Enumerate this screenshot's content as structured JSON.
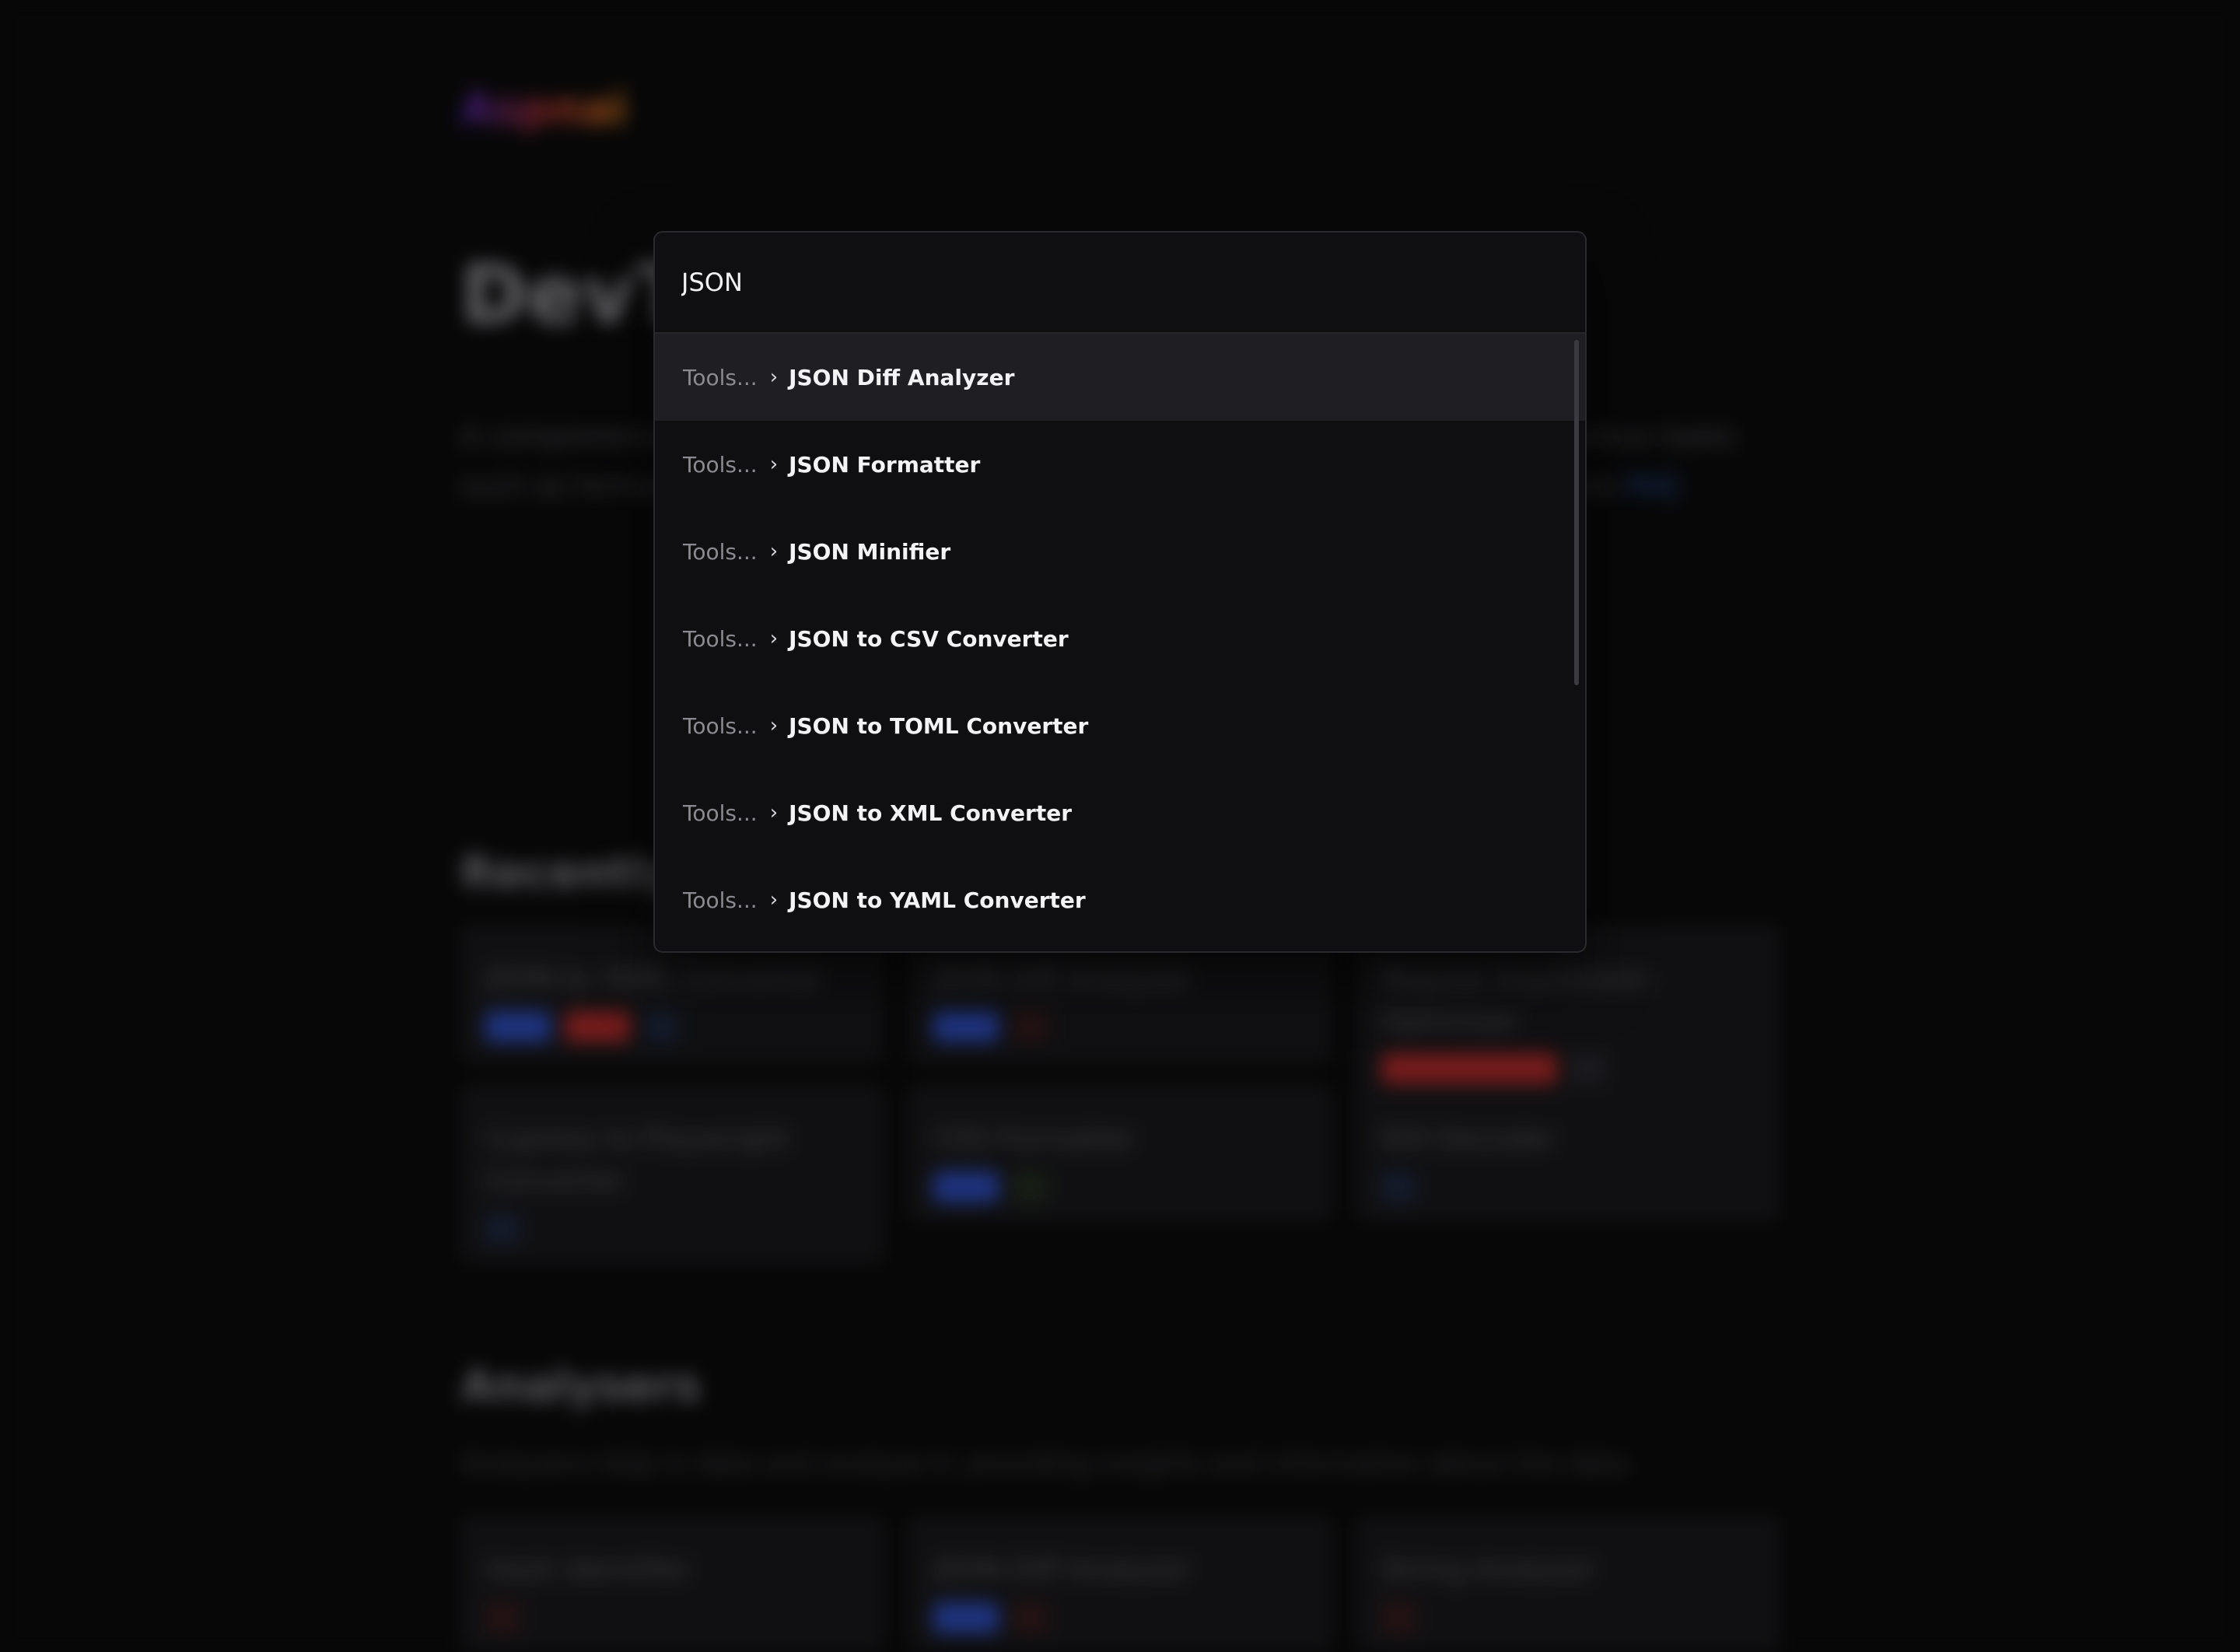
{
  "background": {
    "logo": "Aspnai",
    "hero_title": "DevToolbox",
    "hero_description": "A comprehensive collection of developer tools designed to help you facilitate various tasks such as formatting, converting, analyzing and generating data. Explore them here",
    "hero_link": "FAQ",
    "recent_title": "Recently Used",
    "recent_cards": [
      {
        "title": "JSON to YAML Converter",
        "tags": [
          "blue",
          "red",
          "dimblue"
        ]
      },
      {
        "title": "JSON Diff Analyzer",
        "tags": [
          "blue",
          "dimred"
        ]
      },
      {
        "title": "Regular Expression Optimizer",
        "tags": [
          "red-long",
          "dim"
        ]
      },
      {
        "title": "Cypress to Playwright Converter",
        "tags": [
          "dimblue"
        ]
      },
      {
        "title": "CSS Formatter",
        "tags": [
          "blue",
          "dimgreen"
        ]
      },
      {
        "title": "EDI Decoder",
        "tags": [
          "dimblue"
        ]
      }
    ],
    "analysers_title": "Analysers",
    "analysers_description": "Analysers help in data and analyse it, providing insights and information about the data.",
    "analyser_cards": [
      {
        "title": "Hash Identifier",
        "tags": [
          "dimred"
        ]
      },
      {
        "title": "JSON Diff Analyzer",
        "tags": [
          "blue",
          "dimred"
        ]
      },
      {
        "title": "String Analyser",
        "tags": [
          "dimred"
        ]
      }
    ]
  },
  "palette": {
    "query": "JSON",
    "results": [
      {
        "crumb": "Tools...",
        "separator": "›",
        "name": "JSON Diff Analyzer",
        "active": true
      },
      {
        "crumb": "Tools...",
        "separator": "›",
        "name": "JSON Formatter",
        "active": false
      },
      {
        "crumb": "Tools...",
        "separator": "›",
        "name": "JSON Minifier",
        "active": false
      },
      {
        "crumb": "Tools...",
        "separator": "›",
        "name": "JSON to CSV Converter",
        "active": false
      },
      {
        "crumb": "Tools...",
        "separator": "›",
        "name": "JSON to TOML Converter",
        "active": false
      },
      {
        "crumb": "Tools...",
        "separator": "›",
        "name": "JSON to XML Converter",
        "active": false
      },
      {
        "crumb": "Tools...",
        "separator": "›",
        "name": "JSON to YAML Converter",
        "active": false
      }
    ]
  }
}
